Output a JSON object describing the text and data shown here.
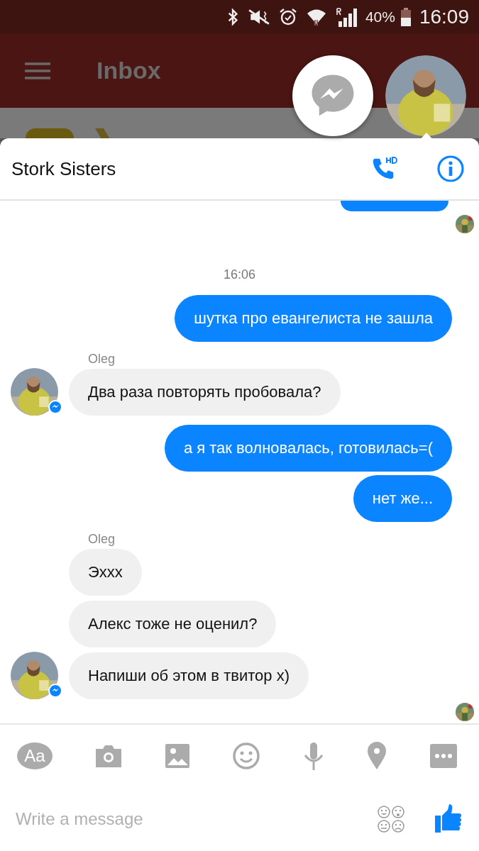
{
  "status_bar": {
    "battery_text": "40%",
    "time": "16:09"
  },
  "app_bar": {
    "title": "Inbox"
  },
  "chat": {
    "title": "Stork Sisters",
    "items": [
      {
        "kind": "cut_outgoing"
      },
      {
        "kind": "receipt"
      },
      {
        "kind": "timestamp",
        "text": "16:06"
      },
      {
        "kind": "outgoing",
        "text": "шутка про евангелиста не зашла"
      },
      {
        "kind": "sender",
        "text": "Oleg"
      },
      {
        "kind": "incoming",
        "text": "Два раза повторять пробовала?",
        "avatar": true
      },
      {
        "kind": "outgoing",
        "text": "а я так волновалась, готовилась=("
      },
      {
        "kind": "outgoing",
        "text": "нет же..."
      },
      {
        "kind": "sender",
        "text": "Oleg"
      },
      {
        "kind": "incoming",
        "text": "Эххх",
        "avatar": false
      },
      {
        "kind": "incoming",
        "text": "Алекс тоже не оценил?",
        "avatar": false
      },
      {
        "kind": "incoming",
        "text": "Напиши об этом в твитор х)",
        "avatar": true
      },
      {
        "kind": "receipt"
      }
    ]
  },
  "composer": {
    "text_button": "Aa",
    "placeholder": "Write a message"
  }
}
